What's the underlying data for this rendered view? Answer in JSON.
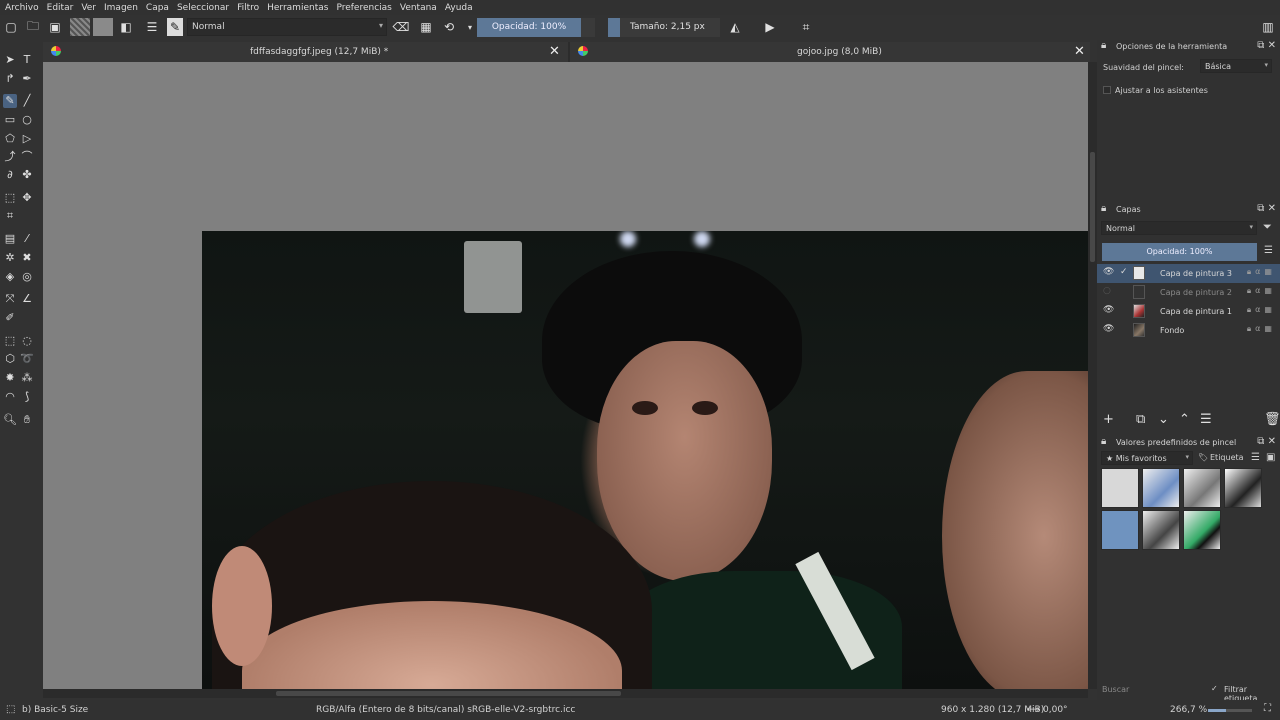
{
  "menu": [
    "Archivo",
    "Editar",
    "Ver",
    "Imagen",
    "Capa",
    "Seleccionar",
    "Filtro",
    "Herramientas",
    "Preferencias",
    "Ventana",
    "Ayuda"
  ],
  "toolbar": {
    "blend_mode": "Normal",
    "opacity_label": "Opacidad: 100%",
    "size_label": "Tamaño: 2,15 px"
  },
  "tabs": [
    {
      "title": "fdffasdaggfgf.jpeg (12,7 MiB) *"
    },
    {
      "title": "gojoo.jpg (8,0 MiB)"
    }
  ],
  "tool_options": {
    "title": "Opciones de la herramienta",
    "smoothing_label": "Suavidad del pincel:",
    "smoothing_value": "Básica",
    "snap_label": "Ajustar a los asistentes"
  },
  "layers": {
    "title": "Capas",
    "blend_mode": "Normal",
    "opacity_label": "Opacidad:  100%",
    "items": [
      {
        "name": "Capa de pintura 3",
        "visible": true,
        "selected": true
      },
      {
        "name": "Capa de pintura 2",
        "visible": false,
        "selected": false
      },
      {
        "name": "Capa de pintura 1",
        "visible": true,
        "selected": false
      },
      {
        "name": "Fondo",
        "visible": true,
        "selected": false
      }
    ]
  },
  "brush_presets": {
    "title": "Valores predefinidos de pincel",
    "favorites": "Mis favoritos",
    "tag": "Etiqueta",
    "search_placeholder": "Buscar",
    "filter_label": "Filtrar etiqueta"
  },
  "status": {
    "brush": "b) Basic-5 Size",
    "colorspace": "RGB/Alfa (Entero de 8 bits/canal)  sRGB-elle-V2-srgbtrc.icc",
    "dimensions": "960 x 1.280 (12,7 MiB)",
    "rotation": "0,00°",
    "zoom": "266,7 %"
  }
}
